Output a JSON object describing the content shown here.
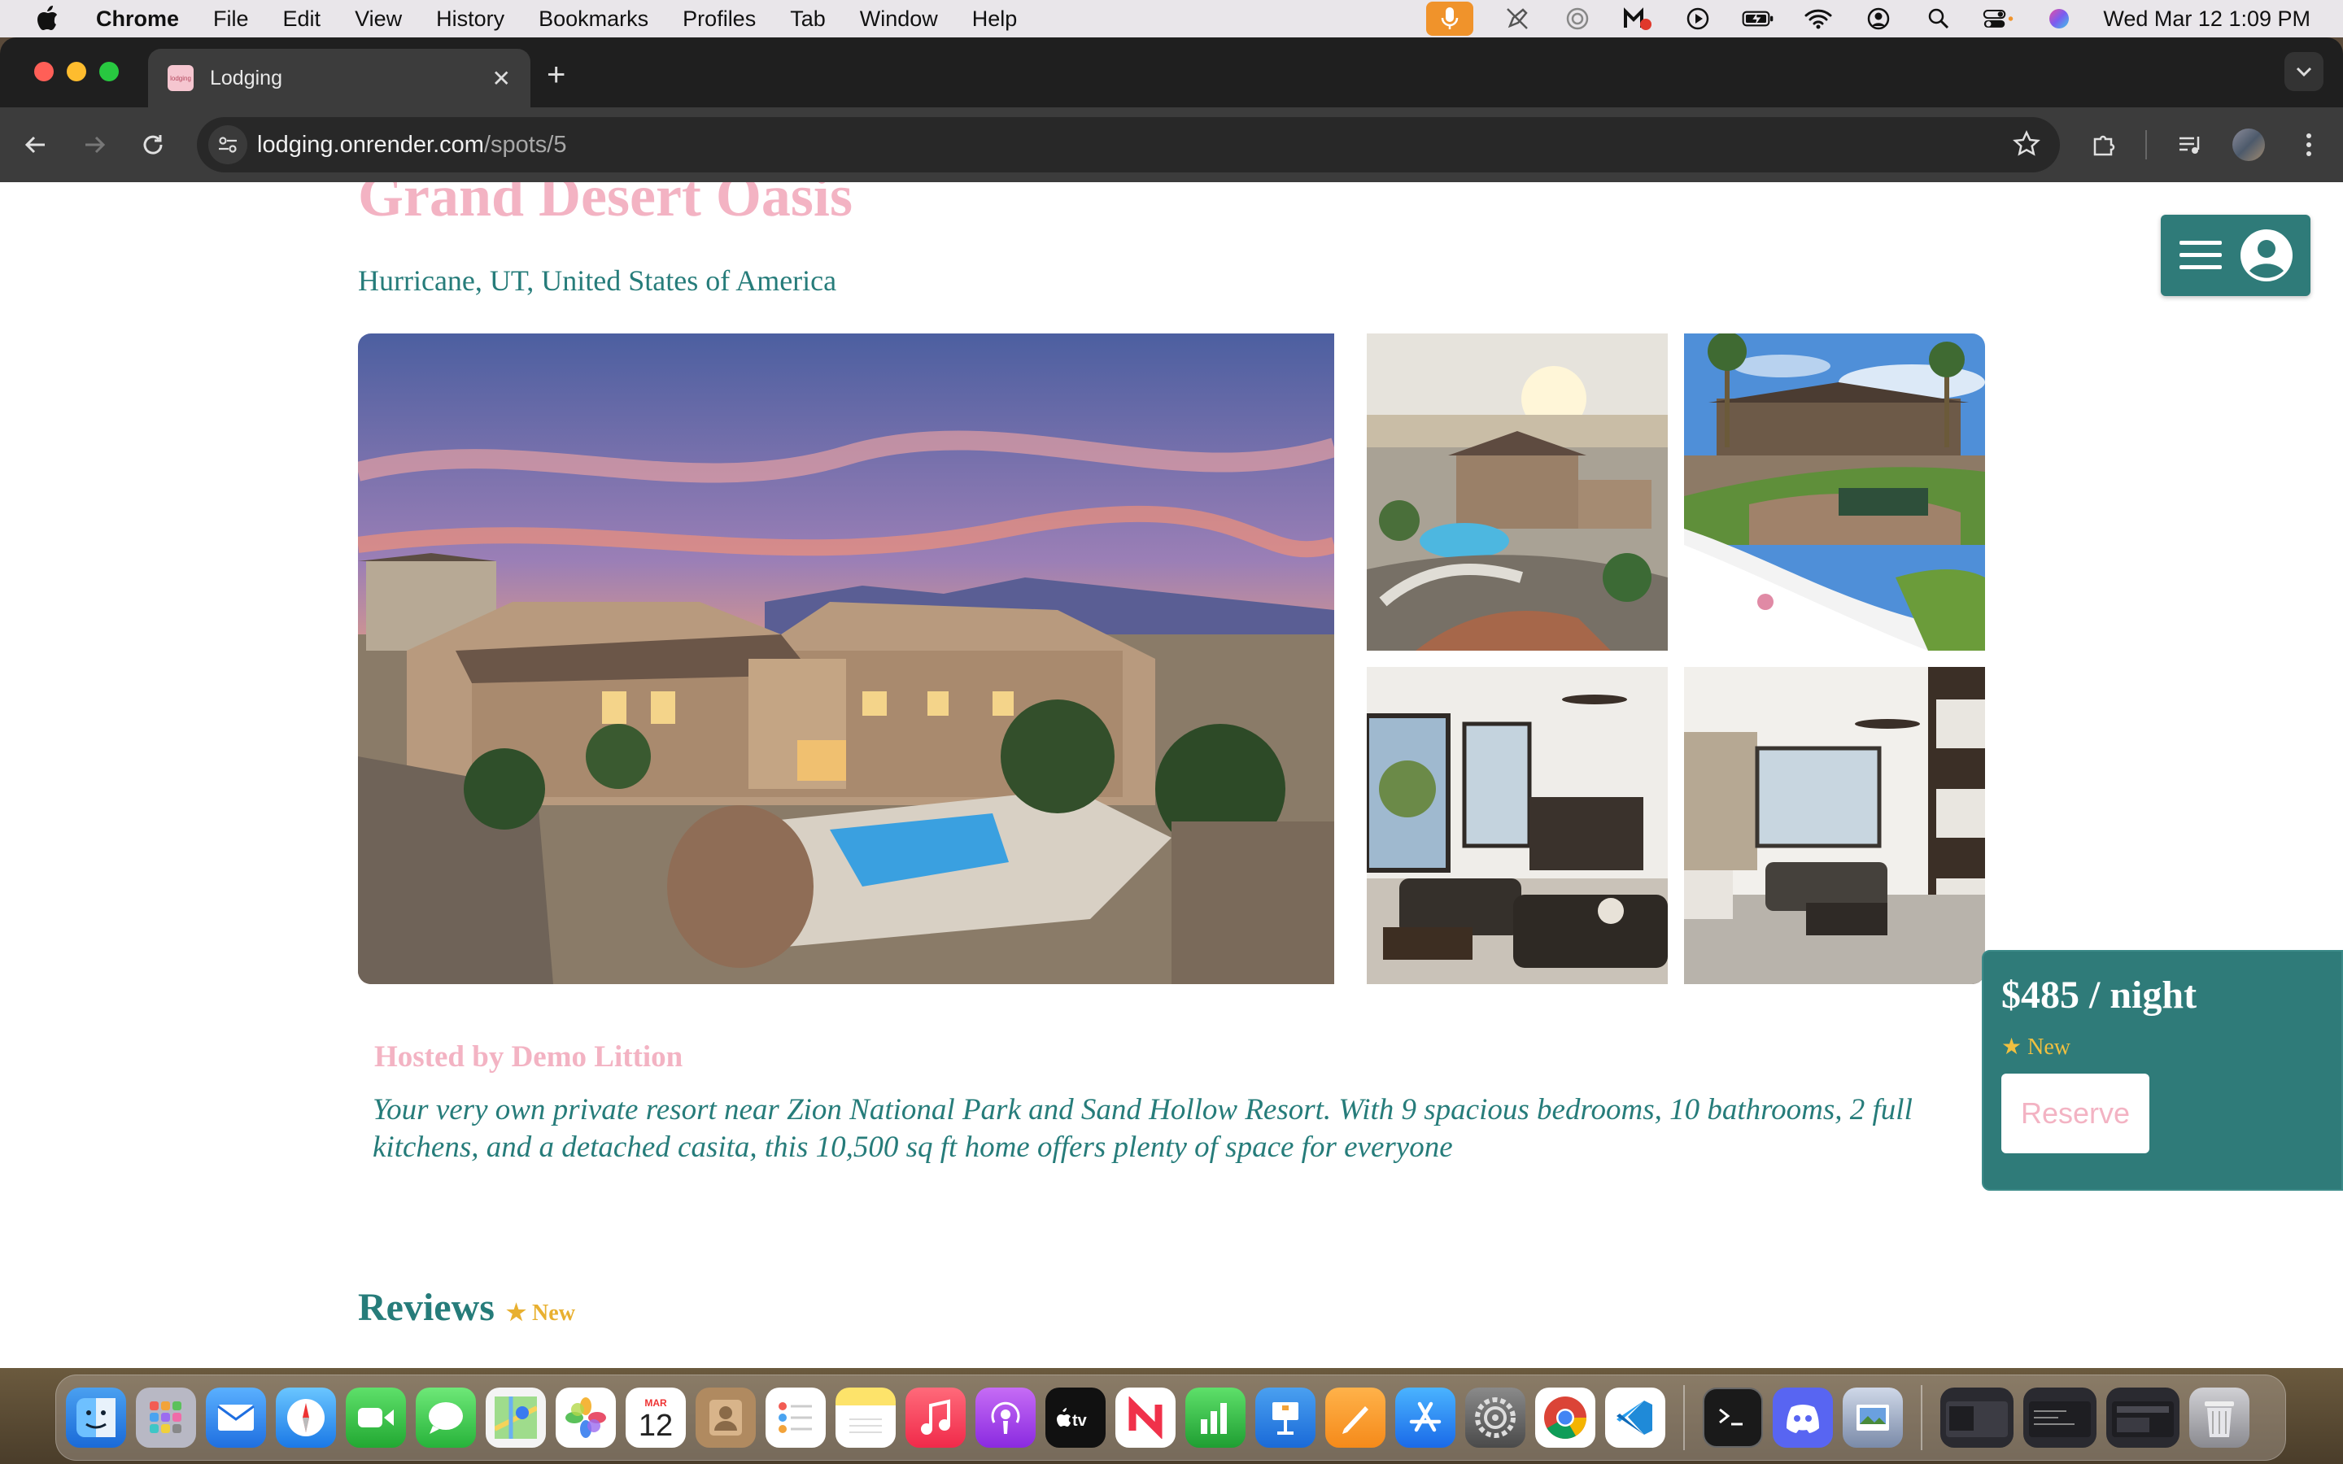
{
  "menubar": {
    "app_name": "Chrome",
    "items": [
      "File",
      "Edit",
      "View",
      "History",
      "Bookmarks",
      "Profiles",
      "Tab",
      "Window",
      "Help"
    ],
    "clock": "Wed Mar 12  1:09 PM"
  },
  "browser": {
    "tab_title": "Lodging",
    "favicon_text": "lodging",
    "url_host": "lodging.onrender.com",
    "url_path": "/spots/5"
  },
  "spot": {
    "title": "Grand Desert Oasis",
    "location": "Hurricane, UT, United States of America",
    "hosted_by": "Hosted by Demo Littion",
    "description": "Your very own private resort near Zion National Park and Sand Hollow Resort. With 9 spacious bedrooms, 10 bathrooms, 2 full kitchens, and a detached casita, this 10,500 sq ft home offers plenty of space for everyone"
  },
  "reserve": {
    "price": "$485 / night",
    "rating": "★ New",
    "button_label": "Reserve"
  },
  "reviews": {
    "title": "Reviews",
    "badge": "★ New"
  },
  "dock": {
    "calendar_month": "MAR",
    "calendar_day": "12"
  },
  "colors": {
    "brand_teal": "#2f7b79",
    "brand_pink": "#f3b3c3",
    "star_gold": "#e8b030"
  }
}
